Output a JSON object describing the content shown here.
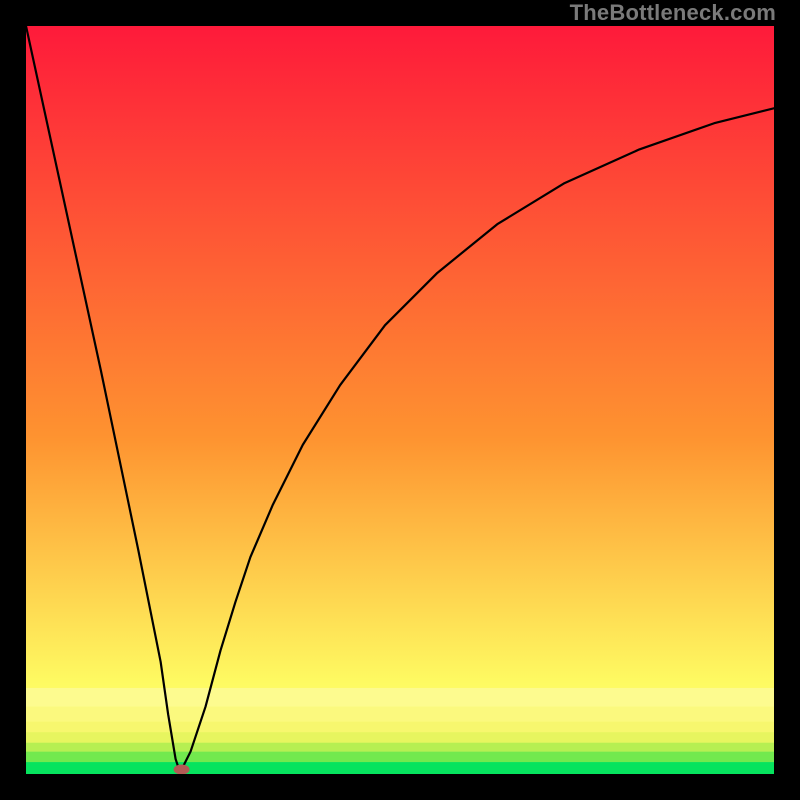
{
  "attribution": "TheBottleneck.com",
  "chart_data": {
    "type": "line",
    "title": "",
    "xlabel": "",
    "ylabel": "",
    "xlim": [
      0,
      100
    ],
    "ylim": [
      0,
      100
    ],
    "curve": {
      "name": "bottleneck-curve",
      "x": [
        0,
        5,
        10,
        15,
        18,
        19,
        20,
        20.5,
        21,
        22,
        24,
        26,
        28,
        30,
        33,
        37,
        42,
        48,
        55,
        63,
        72,
        82,
        92,
        100
      ],
      "y": [
        100,
        77,
        54,
        30,
        15,
        8,
        2,
        0.5,
        1,
        3,
        9,
        16.5,
        23,
        29,
        36,
        44,
        52,
        60,
        67,
        73.5,
        79,
        83.5,
        87,
        89
      ]
    },
    "marker": {
      "x": 20.8,
      "y": 0.6,
      "color": "#b35a55",
      "rx": 8,
      "ry": 5
    },
    "bottom_bands": [
      {
        "y0": 0.0,
        "y1": 1.6,
        "color": "#06e35e"
      },
      {
        "y0": 1.6,
        "y1": 3.0,
        "color": "#72e94e"
      },
      {
        "y0": 3.0,
        "y1": 4.2,
        "color": "#b6ef52"
      },
      {
        "y0": 4.2,
        "y1": 5.6,
        "color": "#e7f55f"
      },
      {
        "y0": 5.6,
        "y1": 7.0,
        "color": "#f7f76e"
      },
      {
        "y0": 7.0,
        "y1": 9.0,
        "color": "#fbf97e"
      },
      {
        "y0": 9.0,
        "y1": 11.5,
        "color": "#fdfb8f"
      }
    ],
    "gradient_top": "#fe1a3a",
    "gradient_mid": "#fe9330",
    "gradient_yellow": "#fefb62"
  }
}
